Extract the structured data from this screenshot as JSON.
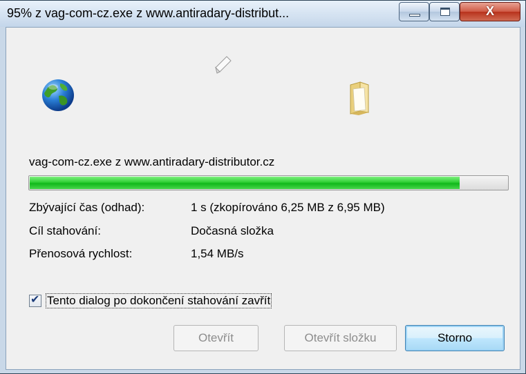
{
  "window": {
    "title": "95% z vag-com-cz.exe z www.antiradary-distribut...",
    "close_glyph": "X"
  },
  "icons": {
    "source": "globe-icon",
    "transfer": "paper-icon",
    "destination": "folder-icon"
  },
  "download": {
    "file_line": "vag-com-cz.exe z www.antiradary-distributor.cz",
    "progress_percent": 90,
    "progress_color": "#22c32a"
  },
  "details": [
    {
      "label": "Zbývající čas (odhad):",
      "value": "1 s (zkopírováno 6,25 MB z 6,95 MB)"
    },
    {
      "label": "Cíl stahování:",
      "value": "Dočasná složka"
    },
    {
      "label": "Přenosová rychlost:",
      "value": "1,54 MB/s"
    }
  ],
  "close_option": {
    "checked": true,
    "label": "Tento dialog po dokončení stahování zavřít"
  },
  "buttons": {
    "open": "Otevřít",
    "open_folder": "Otevřít složku",
    "cancel": "Storno"
  }
}
